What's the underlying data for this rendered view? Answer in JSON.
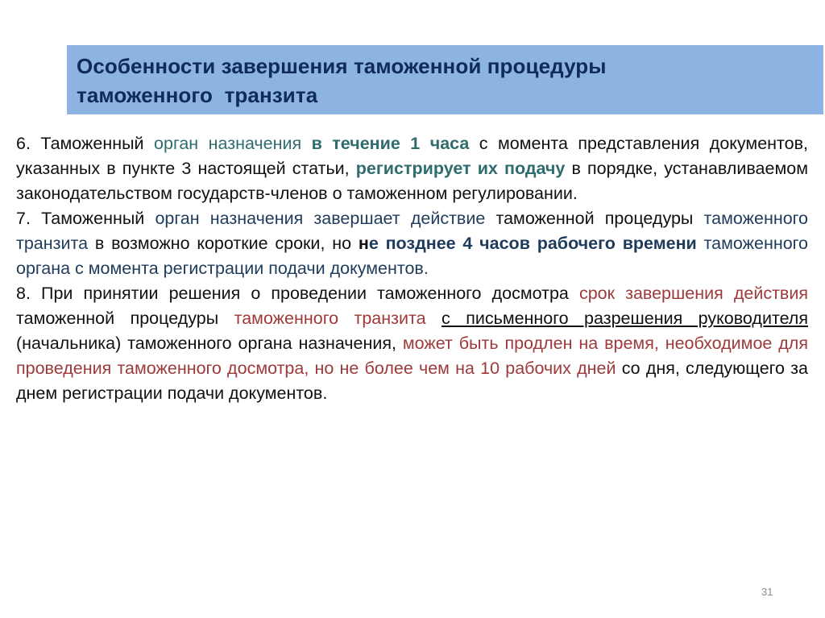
{
  "slide": {
    "title_line1": "Особенности завершения таможенной процедуры",
    "title_line2": "таможенного  транзита",
    "page_number": "31",
    "colors": {
      "title_bg": "#8DB3E2",
      "title_text": "#0F2A5C",
      "teal_highlight": "#2F6C6D",
      "navy_highlight": "#1F3B5C",
      "red_highlight": "#9E3A3A"
    }
  },
  "paragraphs": [
    {
      "number": "6",
      "segments": [
        "6. Таможенный ",
        "орган назначения",
        " ",
        "в течение 1 часа",
        " с момента представления документов, указанных в пункте 3 настоящей статьи, ",
        "регистрирует их подачу",
        " в порядке, устанавливаемом законодательством государств-членов о таможенном регулировании."
      ]
    },
    {
      "number": "7",
      "segments": [
        "7. Таможенный ",
        "орган назначения завершает действие",
        " таможенной процедуры ",
        "таможенного транзита",
        " в возможно короткие сроки, но ",
        "н",
        "е позднее 4 часов рабочего времени",
        " таможенного органа с момента регистрации подачи документов."
      ]
    },
    {
      "number": "8",
      "segments": [
        "8. При принятии решения о проведении таможенного досмотра ",
        "срок завершения действия",
        " таможенной процедуры ",
        "таможенного транзита",
        " ",
        "с письменного разрешения руководителя",
        " (начальника) таможенного органа назначения, ",
        "может быть продлен на время, необходимое для проведения таможенного досмотра, но не более чем на 10 рабочих дней",
        " со дня, следующего за днем регистрации подачи документов."
      ]
    }
  ]
}
